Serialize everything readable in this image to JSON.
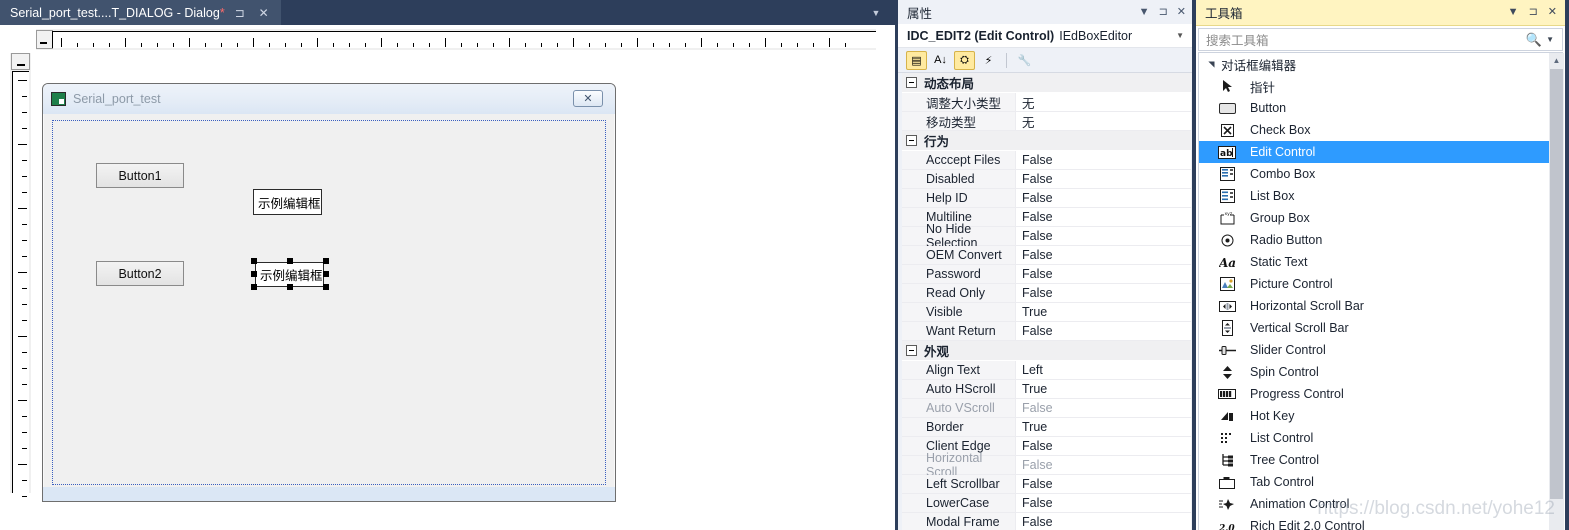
{
  "editor": {
    "tab": {
      "title": "Serial_port_test....T_DIALOG - Dialog",
      "dirty_marker": "*",
      "pin_icon": "pin-icon",
      "close_icon": "close-icon",
      "overflow_icon": "chevron-down-icon"
    },
    "dialog": {
      "title": "Serial_port_test",
      "close_label": "✕",
      "controls": [
        {
          "type": "button",
          "label": "Button1"
        },
        {
          "type": "button",
          "label": "Button2"
        },
        {
          "type": "edit",
          "label": "示例编辑框",
          "selected": false
        },
        {
          "type": "edit",
          "label": "示例编辑框",
          "selected": true
        }
      ]
    }
  },
  "properties": {
    "panel_title": "属性",
    "dropdown_icon": "chevron-down-icon",
    "pin_icon": "pin-icon",
    "close_icon": "close-icon",
    "object_name": "IDC_EDIT2 (Edit Control)",
    "object_editor": "IEdBoxEditor",
    "combo_arrow": "chevron-down-icon",
    "toolbar": [
      {
        "name": "categorized-view-icon",
        "glyph": "▤",
        "active": true
      },
      {
        "name": "alphabetical-sort-icon",
        "glyph": "A↓",
        "active": false
      },
      {
        "name": "properties-page-icon",
        "glyph": "⛭",
        "active": true
      },
      {
        "name": "events-icon",
        "glyph": "⚡",
        "active": false
      },
      {
        "name": "wrench-icon",
        "glyph": "🔧",
        "active": false,
        "disabled": true
      }
    ],
    "categories": [
      {
        "name": "动态布局",
        "rows": [
          {
            "name": "调整大小类型",
            "value": "无",
            "disabled": false
          },
          {
            "name": "移动类型",
            "value": "无",
            "disabled": false
          }
        ]
      },
      {
        "name": "行为",
        "rows": [
          {
            "name": "Acccept Files",
            "value": "False",
            "disabled": false
          },
          {
            "name": "Disabled",
            "value": "False",
            "disabled": false
          },
          {
            "name": "Help ID",
            "value": "False",
            "disabled": false
          },
          {
            "name": "Multiline",
            "value": "False",
            "disabled": false
          },
          {
            "name": "No Hide Selection",
            "value": "False",
            "disabled": false
          },
          {
            "name": "OEM Convert",
            "value": "False",
            "disabled": false
          },
          {
            "name": "Password",
            "value": "False",
            "disabled": false
          },
          {
            "name": "Read Only",
            "value": "False",
            "disabled": false
          },
          {
            "name": "Visible",
            "value": "True",
            "disabled": false
          },
          {
            "name": "Want Return",
            "value": "False",
            "disabled": false
          }
        ]
      },
      {
        "name": "外观",
        "rows": [
          {
            "name": "Align Text",
            "value": "Left",
            "disabled": false
          },
          {
            "name": "Auto HScroll",
            "value": "True",
            "disabled": false
          },
          {
            "name": "Auto VScroll",
            "value": "False",
            "disabled": true
          },
          {
            "name": "Border",
            "value": "True",
            "disabled": false
          },
          {
            "name": "Client Edge",
            "value": "False",
            "disabled": false
          },
          {
            "name": "Horizontal Scroll",
            "value": "False",
            "disabled": true
          },
          {
            "name": "Left Scrollbar",
            "value": "False",
            "disabled": false
          },
          {
            "name": "LowerCase",
            "value": "False",
            "disabled": false
          },
          {
            "name": "Modal Frame",
            "value": "False",
            "disabled": false
          }
        ]
      }
    ]
  },
  "toolbox": {
    "panel_title": "工具箱",
    "dropdown_icon": "chevron-down-icon",
    "pin_icon": "pin-icon",
    "close_icon": "close-icon",
    "search_placeholder": "搜索工具箱",
    "search_icon": "search-icon",
    "search_dropdown_icon": "chevron-down-icon",
    "group": "对话框编辑器",
    "group_icon": "triangle-down-icon",
    "items": [
      {
        "label": "指针",
        "icon": "pointer-icon",
        "selected": false
      },
      {
        "label": "Button",
        "icon": "button-icon",
        "selected": false
      },
      {
        "label": "Check Box",
        "icon": "checkbox-icon",
        "selected": false
      },
      {
        "label": "Edit Control",
        "icon": "edit-control-icon",
        "selected": true
      },
      {
        "label": "Combo Box",
        "icon": "combo-box-icon",
        "selected": false
      },
      {
        "label": "List Box",
        "icon": "list-box-icon",
        "selected": false
      },
      {
        "label": "Group Box",
        "icon": "group-box-icon",
        "selected": false
      },
      {
        "label": "Radio Button",
        "icon": "radio-button-icon",
        "selected": false
      },
      {
        "label": "Static Text",
        "icon": "static-text-icon",
        "selected": false
      },
      {
        "label": "Picture Control",
        "icon": "picture-control-icon",
        "selected": false
      },
      {
        "label": "Horizontal Scroll Bar",
        "icon": "horizontal-scrollbar-icon",
        "selected": false
      },
      {
        "label": "Vertical Scroll Bar",
        "icon": "vertical-scrollbar-icon",
        "selected": false
      },
      {
        "label": "Slider Control",
        "icon": "slider-icon",
        "selected": false
      },
      {
        "label": "Spin Control",
        "icon": "spin-icon",
        "selected": false
      },
      {
        "label": "Progress Control",
        "icon": "progress-icon",
        "selected": false
      },
      {
        "label": "Hot Key",
        "icon": "hotkey-icon",
        "selected": false
      },
      {
        "label": "List Control",
        "icon": "list-control-icon",
        "selected": false
      },
      {
        "label": "Tree Control",
        "icon": "tree-control-icon",
        "selected": false
      },
      {
        "label": "Tab Control",
        "icon": "tab-control-icon",
        "selected": false
      },
      {
        "label": "Animation Control",
        "icon": "animation-icon",
        "selected": false
      },
      {
        "label": "Rich Edit 2.0 Control",
        "icon": "rich-edit-icon",
        "selected": false
      }
    ],
    "scroll_up_icon": "triangle-up-icon"
  },
  "watermark": "https://blog.csdn.net/yohe12",
  "colors": {
    "chrome": "#2d3e5b",
    "tab_active": "#41536e",
    "toolbox_header": "#fff4c1",
    "selection": "#2e9bff"
  }
}
